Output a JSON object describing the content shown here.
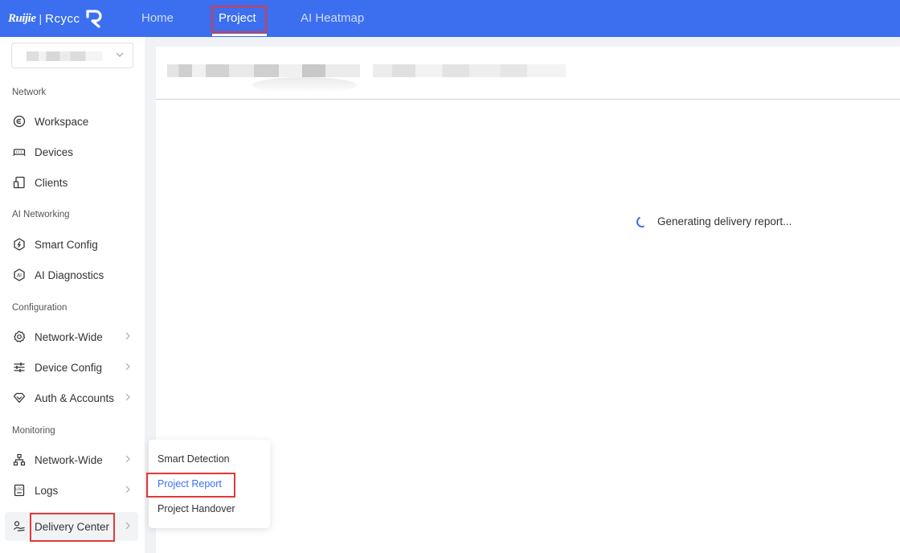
{
  "topbar": {
    "brand": "Ruijie",
    "brand_separator": "|",
    "brand_sub": "Rcycc",
    "nav": [
      {
        "label": "Home",
        "active": false
      },
      {
        "label": "Project",
        "active": true
      },
      {
        "label": "AI Heatmap",
        "active": false
      }
    ],
    "color": "#3b6ff0"
  },
  "sidebar": {
    "sections": [
      {
        "label": "Network",
        "items": [
          {
            "label": "Workspace",
            "icon": "workspace-icon",
            "has_arrow": false
          },
          {
            "label": "Devices",
            "icon": "devices-icon",
            "has_arrow": false
          },
          {
            "label": "Clients",
            "icon": "clients-icon",
            "has_arrow": false
          }
        ]
      },
      {
        "label": "AI Networking",
        "items": [
          {
            "label": "Smart Config",
            "icon": "smart-config-icon",
            "has_arrow": false
          },
          {
            "label": "AI Diagnostics",
            "icon": "ai-diagnostics-icon",
            "has_arrow": false
          }
        ]
      },
      {
        "label": "Configuration",
        "items": [
          {
            "label": "Network-Wide",
            "icon": "gear-icon",
            "has_arrow": true
          },
          {
            "label": "Device Config",
            "icon": "sliders-icon",
            "has_arrow": true
          },
          {
            "label": "Auth & Accounts",
            "icon": "diamond-icon",
            "has_arrow": true
          }
        ]
      },
      {
        "label": "Monitoring",
        "items": [
          {
            "label": "Network-Wide",
            "icon": "topology-icon",
            "has_arrow": true
          },
          {
            "label": "Logs",
            "icon": "logs-icon",
            "has_arrow": true
          },
          {
            "label": "Delivery Center",
            "icon": "handshake-icon",
            "has_arrow": true,
            "selected": true
          }
        ]
      }
    ]
  },
  "main": {
    "loading_text": "Generating delivery report..."
  },
  "flyout": {
    "items": [
      {
        "label": "Smart Detection",
        "active": false
      },
      {
        "label": "Project Report",
        "active": true
      },
      {
        "label": "Project Handover",
        "active": false
      }
    ]
  },
  "colors": {
    "accent": "#3b6ff0",
    "highlight": "#e03a3a"
  }
}
